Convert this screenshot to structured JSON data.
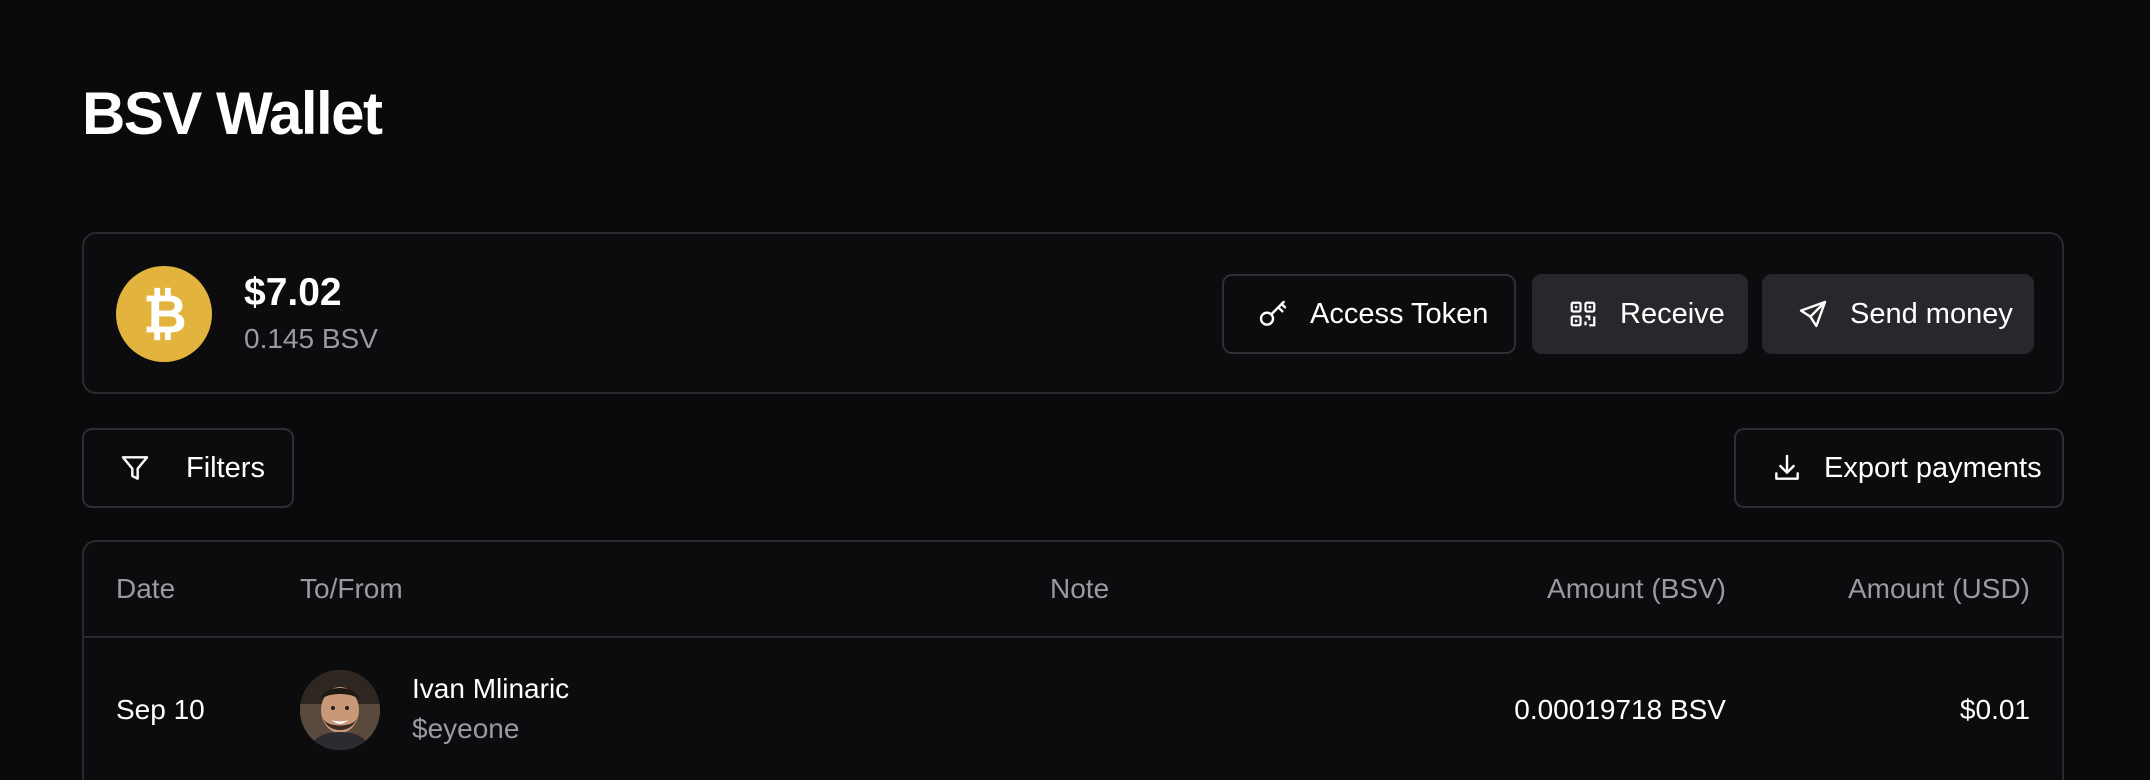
{
  "page": {
    "title": "BSV Wallet"
  },
  "balance": {
    "usd": "$7.02",
    "bsv": "0.145 BSV",
    "coin_icon": "bitcoin-sv-icon",
    "coin_color": "#e3b43d"
  },
  "actions": {
    "access_token_label": "Access Token",
    "access_token_icon": "key-icon",
    "receive_label": "Receive",
    "receive_icon": "qr-code-icon",
    "send_label": "Send money",
    "send_icon": "send-icon"
  },
  "toolbar": {
    "filters_label": "Filters",
    "filters_icon": "filter-icon",
    "export_label": "Export payments",
    "export_icon": "download-icon"
  },
  "table": {
    "columns": {
      "date": "Date",
      "to_from": "To/From",
      "note": "Note",
      "amount_bsv": "Amount (BSV)",
      "amount_usd": "Amount (USD)"
    },
    "rows": [
      {
        "date": "Sep 10",
        "name": "Ivan Mlinaric",
        "handle": "$eyeone",
        "note": "",
        "amount_bsv": "0.00019718 BSV",
        "amount_usd": "$0.01"
      }
    ]
  }
}
